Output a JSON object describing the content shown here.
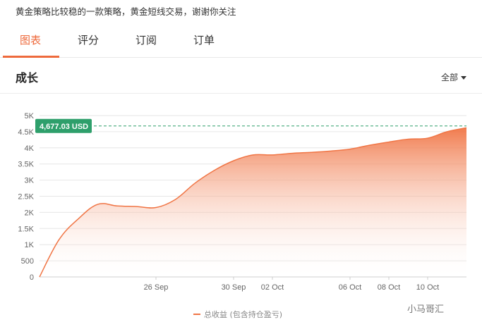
{
  "header": {
    "description": "黄金策略比较稳的一款策略，黄金短线交易，谢谢你关注"
  },
  "tabs": [
    {
      "label": "图表",
      "active": true
    },
    {
      "label": "评分",
      "active": false
    },
    {
      "label": "订阅",
      "active": false
    },
    {
      "label": "订单",
      "active": false
    }
  ],
  "section": {
    "title": "成长",
    "range_label": "全部"
  },
  "colors": {
    "accent": "#ee6a3c",
    "line": "#f07545",
    "badge": "#2e9f6b"
  },
  "chart_data": {
    "type": "area",
    "x": [
      "2023-09-20",
      "2023-09-21",
      "2023-09-22",
      "2023-09-23",
      "2023-09-24",
      "2023-09-25",
      "2023-09-26",
      "2023-09-27",
      "2023-09-28",
      "2023-09-29",
      "2023-09-30",
      "2023-10-01",
      "2023-10-02",
      "2023-10-03",
      "2023-10-04",
      "2023-10-05",
      "2023-10-06",
      "2023-10-07",
      "2023-10-08",
      "2023-10-09",
      "2023-10-10",
      "2023-10-11",
      "2023-10-12"
    ],
    "series": [
      {
        "name": "总收益 (包含持仓盈亏)",
        "values": [
          0,
          1150,
          1800,
          2250,
          2200,
          2180,
          2150,
          2400,
          2900,
          3300,
          3600,
          3780,
          3780,
          3830,
          3860,
          3900,
          3960,
          4080,
          4180,
          4270,
          4300,
          4500,
          4620
        ]
      }
    ],
    "last_value_label": "4,677.03 USD",
    "last_value": 4677.03,
    "yticks": [
      "0",
      "500",
      "1K",
      "1.5K",
      "2K",
      "2.5K",
      "3K",
      "3.5K",
      "4K",
      "4.5K",
      "5K"
    ],
    "ytick_values": [
      0,
      500,
      1000,
      1500,
      2000,
      2500,
      3000,
      3500,
      4000,
      4500,
      5000
    ],
    "xticks": [
      "26 Sep",
      "30 Sep",
      "02 Oct",
      "06 Oct",
      "08 Oct",
      "10 Oct"
    ],
    "xtick_dates": [
      "2023-09-26",
      "2023-09-30",
      "2023-10-02",
      "2023-10-06",
      "2023-10-08",
      "2023-10-10"
    ],
    "ylim": [
      0,
      5000
    ],
    "grid": true,
    "legend": "bottom-center"
  },
  "watermark": "小马哥汇"
}
